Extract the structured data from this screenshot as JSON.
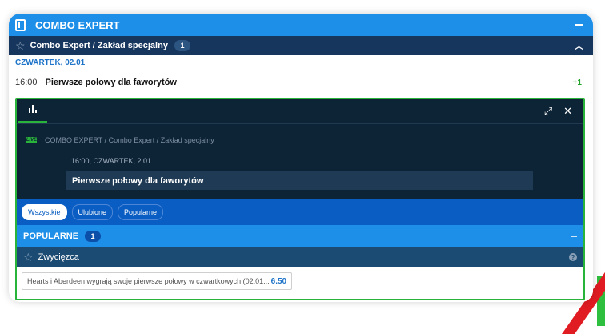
{
  "header": {
    "title": "COMBO EXPERT",
    "icon": "book-icon"
  },
  "subheader": {
    "title": "Combo Expert / Zakład specjalny",
    "count": "1"
  },
  "date": "CZWARTEK, 02.01",
  "match": {
    "time": "16:00",
    "name": "Pierwsze połowy dla faworytów",
    "more": "+1"
  },
  "detail": {
    "breadcrumb": "COMBO EXPERT / Combo Expert / Zakład specjalny",
    "datetime": "16:00, CZWARTEK, 2.01",
    "event": "Pierwsze połowy dla faworytów"
  },
  "filters": [
    "Wszystkie",
    "Ulubione",
    "Popularne"
  ],
  "popular": {
    "title": "POPULARNE",
    "count": "1"
  },
  "market": {
    "name": "Zwycięzca"
  },
  "selection": {
    "label": "Hearts i Aberdeen wygrają swoje pierwsze połowy w czwartkowych (02.01...",
    "odds": "6.50"
  },
  "colors": {
    "accent": "#1e8fe8",
    "dark": "#0d2336",
    "green": "#2ab33a",
    "odds": "#1e74c8"
  }
}
